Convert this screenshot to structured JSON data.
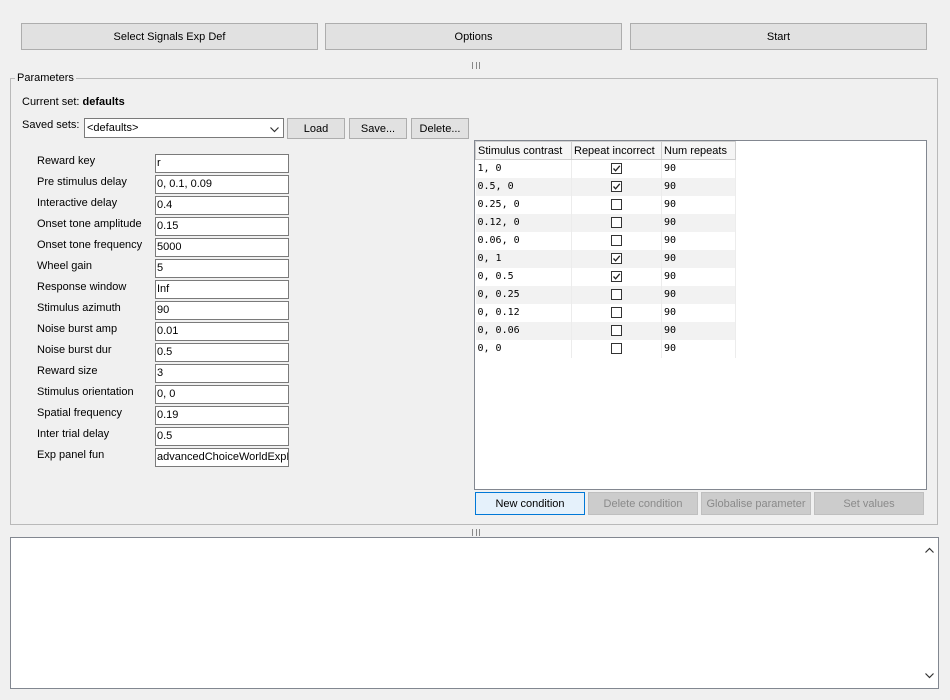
{
  "toolbar": {
    "select_signals_label": "Select Signals Exp Def",
    "options_label": "Options",
    "start_label": "Start"
  },
  "parameters": {
    "title": "Parameters",
    "current_set_label": "Current set:",
    "current_set_value": "defaults",
    "saved_sets_label": "Saved sets:",
    "saved_sets_selected": "<defaults>",
    "load_label": "Load",
    "save_label": "Save...",
    "delete_label": "Delete...",
    "fields": [
      {
        "label": "Reward key",
        "value": "r"
      },
      {
        "label": "Pre stimulus delay",
        "value": "0, 0.1, 0.09"
      },
      {
        "label": "Interactive delay",
        "value": "0.4"
      },
      {
        "label": "Onset tone amplitude",
        "value": "0.15"
      },
      {
        "label": "Onset tone frequency",
        "value": "5000"
      },
      {
        "label": "Wheel gain",
        "value": "5"
      },
      {
        "label": "Response window",
        "value": "Inf"
      },
      {
        "label": "Stimulus azimuth",
        "value": "90"
      },
      {
        "label": "Noise burst amp",
        "value": "0.01"
      },
      {
        "label": "Noise burst dur",
        "value": "0.5"
      },
      {
        "label": "Reward size",
        "value": "3"
      },
      {
        "label": "Stimulus orientation",
        "value": "0, 0"
      },
      {
        "label": "Spatial frequency",
        "value": "0.19"
      },
      {
        "label": "Inter trial delay",
        "value": "0.5"
      },
      {
        "label": "Exp panel fun",
        "value": "advancedChoiceWorldExpP"
      }
    ]
  },
  "conditions": {
    "columns": [
      "Stimulus contrast",
      "Repeat incorrect",
      "Num repeats"
    ],
    "rows": [
      {
        "contrast": "1, 0",
        "repeat_incorrect": true,
        "num_repeats": "90"
      },
      {
        "contrast": "0.5, 0",
        "repeat_incorrect": true,
        "num_repeats": "90"
      },
      {
        "contrast": "0.25, 0",
        "repeat_incorrect": false,
        "num_repeats": "90"
      },
      {
        "contrast": "0.12, 0",
        "repeat_incorrect": false,
        "num_repeats": "90"
      },
      {
        "contrast": "0.06, 0",
        "repeat_incorrect": false,
        "num_repeats": "90"
      },
      {
        "contrast": "0, 1",
        "repeat_incorrect": true,
        "num_repeats": "90"
      },
      {
        "contrast": "0, 0.5",
        "repeat_incorrect": true,
        "num_repeats": "90"
      },
      {
        "contrast": "0, 0.25",
        "repeat_incorrect": false,
        "num_repeats": "90"
      },
      {
        "contrast": "0, 0.12",
        "repeat_incorrect": false,
        "num_repeats": "90"
      },
      {
        "contrast": "0, 0.06",
        "repeat_incorrect": false,
        "num_repeats": "90"
      },
      {
        "contrast": "0, 0",
        "repeat_incorrect": false,
        "num_repeats": "90"
      }
    ],
    "new_condition_label": "New condition",
    "delete_condition_label": "Delete condition",
    "globalise_parameter_label": "Globalise parameter",
    "set_values_label": "Set values"
  },
  "log": {
    "text": ""
  },
  "icons": {
    "dropdown": "chevron-down-icon",
    "scroll_up": "chevron-up-icon",
    "scroll_down": "chevron-down-icon",
    "splitter": "splitter-grip-icon",
    "checkbox": "checkmark-icon"
  }
}
